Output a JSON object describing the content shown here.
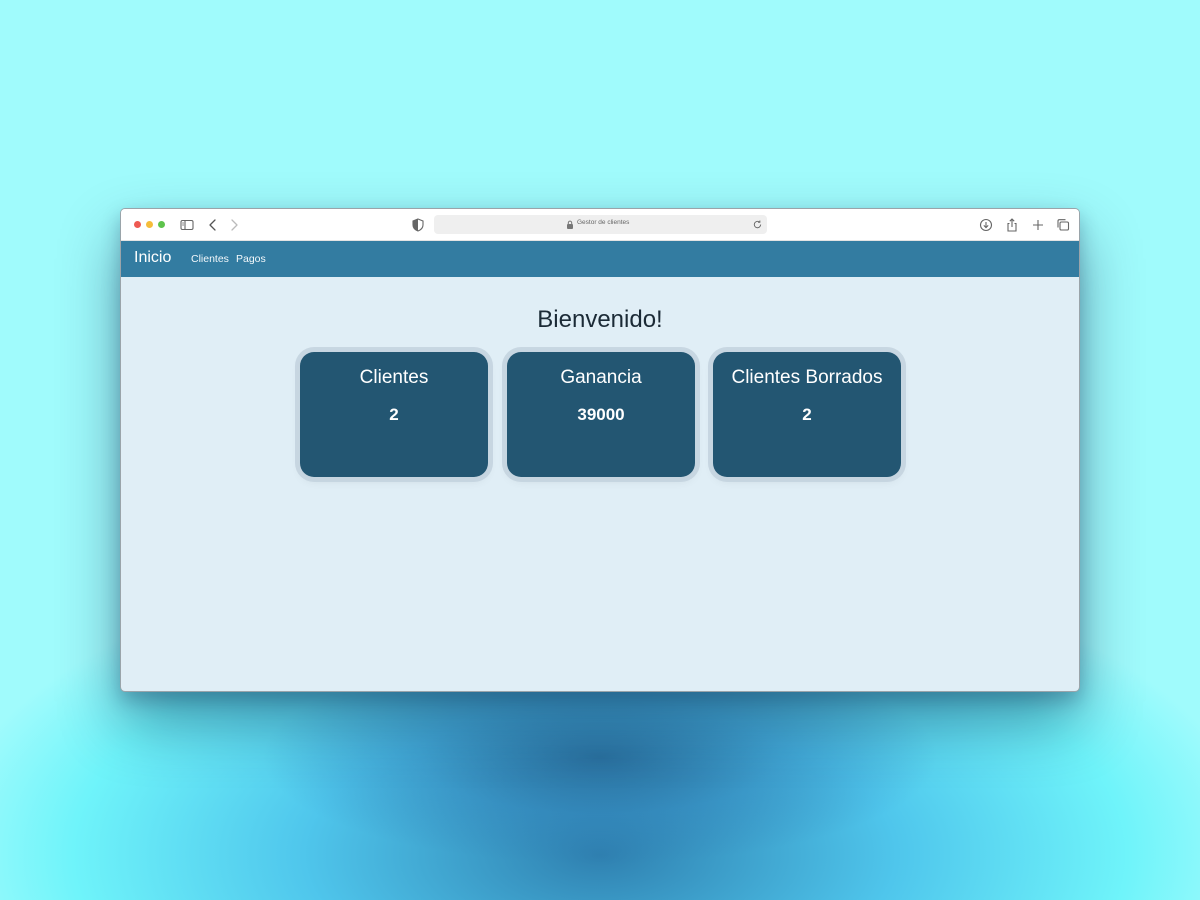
{
  "browser": {
    "address_text": "Gestor de clientes"
  },
  "navbar": {
    "brand": "Inicio",
    "links": [
      "Clientes",
      "Pagos"
    ]
  },
  "main": {
    "heading": "Bienvenido!",
    "cards": [
      {
        "title": "Clientes",
        "value": "2"
      },
      {
        "title": "Ganancia",
        "value": "39000"
      },
      {
        "title": "Clientes Borrados",
        "value": "2"
      }
    ]
  },
  "icons": {
    "sidebar": "sidebar-toggle-icon",
    "back": "chevron-left-icon",
    "forward": "chevron-right-icon",
    "privacy": "shield-icon",
    "lock": "lock-icon",
    "reload": "reload-icon",
    "download": "download-icon",
    "share": "share-icon",
    "new_tab": "plus-icon",
    "tabs": "tabs-overview-icon"
  },
  "colors": {
    "navbar": "#337ca1",
    "card": "#235672",
    "content_bg": "#e0eef6"
  }
}
